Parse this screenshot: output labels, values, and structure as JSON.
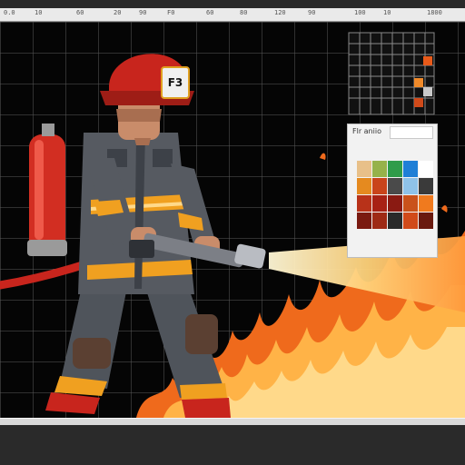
{
  "ruler": {
    "labels": [
      "0.0",
      "10",
      "60",
      "20",
      "90",
      "F0",
      "60",
      "80",
      "120",
      "90",
      "100",
      "10",
      "1800"
    ]
  },
  "badge": {
    "text": "F3"
  },
  "swatch_panel": {
    "title": "Flr aniio",
    "colors": [
      "#e8c089",
      "#96b24a",
      "#2f9c4a",
      "#1f7fd6",
      "#ffffff",
      "#e58a1f",
      "#c9441b",
      "#4a4a4a",
      "#8fc2e8",
      "#3a3a3a",
      "#b83219",
      "#a82115",
      "#8a1a12",
      "#c9521b",
      "#f07a1e",
      "#7a1a10",
      "#9e2a15",
      "#2a2a2a",
      "#d04a1a",
      "#6a1a0f"
    ]
  },
  "colors": {
    "canvas": "#050505",
    "grid": "#5a5a5a",
    "fire_orange": "#ef6a1c",
    "fire_yellow": "#ffb347",
    "coat": "#565a61",
    "hose_red": "#c8251d"
  }
}
